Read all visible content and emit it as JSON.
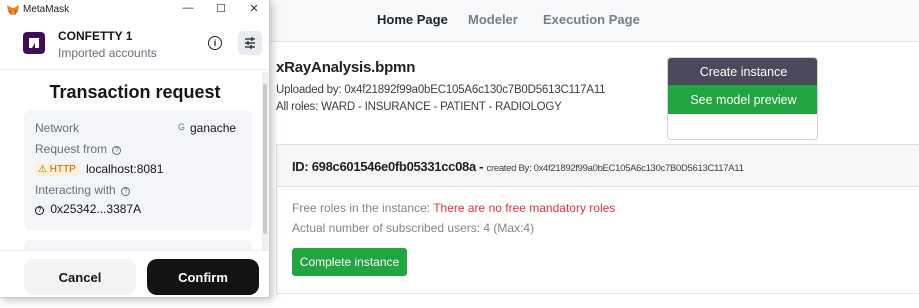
{
  "nav": {
    "items": [
      {
        "label": "Home Page"
      },
      {
        "label": "Modeler"
      },
      {
        "label": "Execution Page"
      }
    ]
  },
  "file": {
    "title": "xRayAnalysis.bpmn",
    "uploaded_by": "Uploaded by: 0x4f21892f99a0bEC105A6c130c7B0D5613C117A11",
    "roles": "All roles: WARD - INSURANCE - PATIENT - RADIOLOGY"
  },
  "actions": {
    "create_instance": "Create instance",
    "see_preview": "See model preview"
  },
  "instance": {
    "id": "ID: 698c601546e0fb05331cc08a -",
    "created_by": "created By: 0x4f21892f99a0bEC105A6c130c7B0D5613C117A11",
    "free_roles_label": "Free roles in the instance:",
    "free_roles_value": "There are no free mandatory roles",
    "subscribed": "Actual number of subscribed users: 4 (Max:4)",
    "complete_label": "Complete instance"
  },
  "metamask": {
    "window_title": "MetaMask",
    "window_controls": {
      "minimize": "—",
      "maximize": "☐",
      "close": "✕"
    },
    "account_name": "CONFETTY 1",
    "account_sub": "Imported accounts",
    "heading": "Transaction request",
    "network_label": "Network",
    "network_badge": "G",
    "network_value": "ganache",
    "request_from_label": "Request from",
    "http_badge": "⚠ HTTP",
    "request_from_value": "localhost:8081",
    "interacting_label": "Interacting with",
    "interacting_value": "0x25342...3387A",
    "question_mark": "?",
    "info_mark": "i",
    "cancel": "Cancel",
    "confirm": "Confirm"
  },
  "colors": {
    "green": "#22a540",
    "dark_button": "#4a4a5a",
    "red_text": "#dc3545",
    "metamask_confirm": "#121314"
  }
}
